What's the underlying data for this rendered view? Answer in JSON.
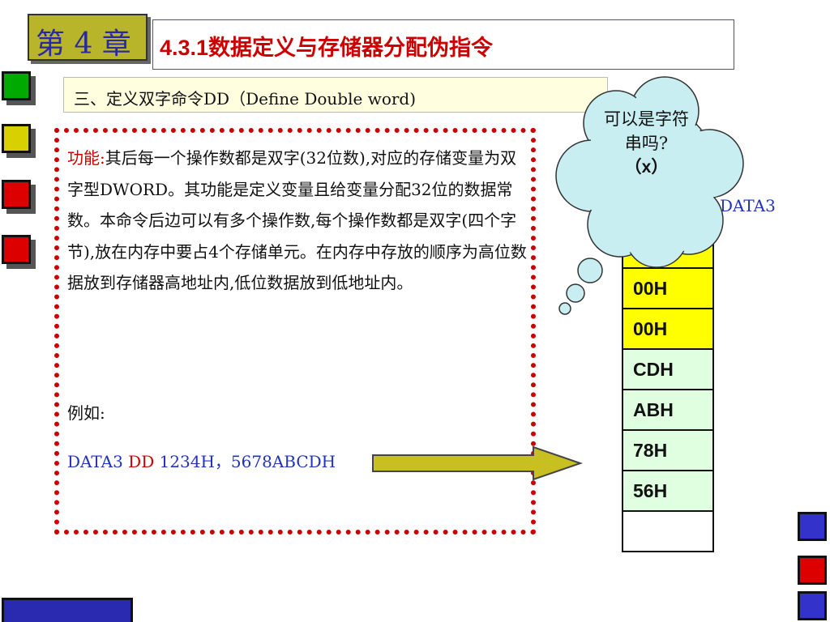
{
  "header": {
    "chapter_label": "第 4 章",
    "section_title": "4.3.1数据定义与存储器分配伪指令"
  },
  "subtitle": "三、定义双字命令DD（Define Double word)",
  "description": {
    "label": "功能:",
    "body": "其后每一个操作数都是双字(32位数),对应的存储变量为双字型DWORD。其功能是定义变量且给变量分配32位的数据常数。本命令后边可以有多个操作数,每个操作数都是双字(四个字节),放在内存中要占4个存储单元。在内存中存放的顺序为高位数据放到存储器高地址内,低位数据放到低地址内。",
    "example_label": "例如:",
    "example_var": "DATA3 ",
    "example_kw": "DD",
    "example_ops": " 1234H，5678ABCDH"
  },
  "memory": {
    "label": "DATA3",
    "cells": [
      {
        "value": "",
        "color": "#ffff00"
      },
      {
        "value": "00H",
        "color": "#ffff00"
      },
      {
        "value": "00H",
        "color": "#ffff00"
      },
      {
        "value": "CDH",
        "color": "#e0ffe0"
      },
      {
        "value": "ABH",
        "color": "#e0ffe0"
      },
      {
        "value": "78H",
        "color": "#e0ffe0"
      },
      {
        "value": "56H",
        "color": "#e0ffe0"
      },
      {
        "value": "",
        "color": "#ffffff"
      }
    ]
  },
  "callout": {
    "question": "可以是字符串吗?",
    "answer": "（x）"
  },
  "colors": {
    "chapter_badge": "#b8b52a",
    "title_text": "#cc0000",
    "subtitle_bg": "#ffffe0",
    "panel_border": "#cc0000",
    "cloud_fill": "#c8eef2",
    "arrow_fill": "#c8c020",
    "code_blue": "#2233bb",
    "square_green": "#00aa00",
    "square_yellow": "#d8d000",
    "square_red": "#dd0000",
    "square_blue": "#3333cc"
  }
}
